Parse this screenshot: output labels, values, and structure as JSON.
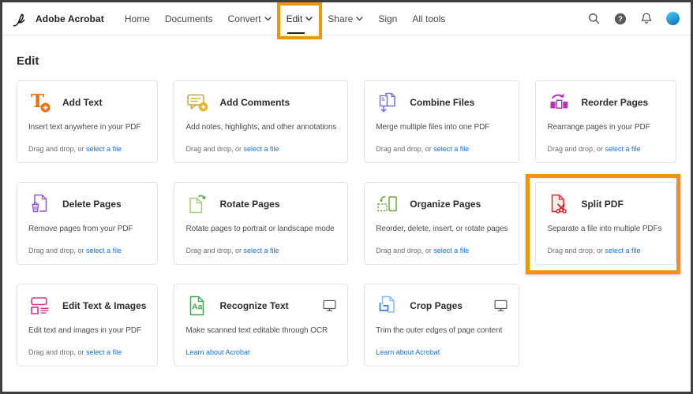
{
  "nav": {
    "brand": "Adobe Acrobat",
    "items": [
      {
        "label": "Home"
      },
      {
        "label": "Documents"
      },
      {
        "label": "Convert",
        "caret": true
      },
      {
        "label": "Edit",
        "caret": true,
        "active": true
      },
      {
        "label": "Share",
        "caret": true
      },
      {
        "label": "Sign"
      },
      {
        "label": "All tools"
      }
    ],
    "icons": [
      "search-icon",
      "help-icon",
      "notifications-bell-icon",
      "account-avatar"
    ],
    "help_glyph": "?"
  },
  "page": {
    "heading": "Edit"
  },
  "annotations": {
    "highlight_color": "#F2930D",
    "highlighted_nav_item": "Edit",
    "highlighted_card": "Split PDF"
  },
  "cards": [
    {
      "icon": "add-text-icon",
      "title": "Add Text",
      "desc": "Insert text anywhere in your PDF",
      "footer": {
        "prefix": "Drag and drop, or ",
        "link": "select a file"
      }
    },
    {
      "icon": "add-comments-icon",
      "title": "Add Comments",
      "desc": "Add notes, highlights, and other annotations",
      "footer": {
        "prefix": "Drag and drop, or ",
        "link": "select a file"
      }
    },
    {
      "icon": "combine-files-icon",
      "title": "Combine Files",
      "desc": "Merge multiple files into one PDF",
      "footer": {
        "prefix": "Drag and drop, or ",
        "link": "select a file"
      }
    },
    {
      "icon": "reorder-pages-icon",
      "title": "Reorder Pages",
      "desc": "Rearrange pages in your PDF",
      "footer": {
        "prefix": "Drag and drop, or ",
        "link": "select a file"
      }
    },
    {
      "icon": "delete-pages-icon",
      "title": "Delete Pages",
      "desc": "Remove pages from your PDF",
      "footer": {
        "prefix": "Drag and drop, or ",
        "link": "select a file"
      }
    },
    {
      "icon": "rotate-pages-icon",
      "title": "Rotate Pages",
      "desc": "Rotate pages to portrait or landscape mode",
      "footer": {
        "prefix": "Drag and drop, or ",
        "link": "select a file"
      }
    },
    {
      "icon": "organize-pages-icon",
      "title": "Organize Pages",
      "desc": "Reorder, delete, insert, or rotate pages",
      "footer": {
        "prefix": "Drag and drop, or ",
        "link": "select a file"
      }
    },
    {
      "icon": "split-pdf-icon",
      "title": "Split PDF",
      "desc": "Separate a file into multiple PDFs",
      "footer": {
        "prefix": "Drag and drop, or ",
        "link": "select a file"
      },
      "highlighted": true
    },
    {
      "icon": "edit-text-images-icon",
      "title": "Edit Text & Images",
      "desc": "Edit text and images in your PDF",
      "footer": {
        "prefix": "Drag and drop, or ",
        "link": "select a file"
      }
    },
    {
      "icon": "recognize-text-icon",
      "title": "Recognize Text",
      "desc": "Make scanned text editable through OCR",
      "footer": {
        "link": "Learn about Acrobat"
      },
      "desktop_only": true
    },
    {
      "icon": "crop-pages-icon",
      "title": "Crop Pages",
      "desc": "Trim the outer edges of page content",
      "footer": {
        "link": "Learn about Acrobat"
      },
      "desktop_only": true
    }
  ],
  "colors": {
    "annotation_orange": "#F2930D",
    "link_blue": "#1473E6",
    "add_text_orange": "#E8720C",
    "add_comments_gold": "#D9A909",
    "combine_files_periwinkle": "#7373E8",
    "reorder_pages_magenta": "#BC2EC4",
    "delete_pages_purple": "#9256D9",
    "rotate_pages_green": "#7FB84B",
    "organize_pages_green": "#6FA83C",
    "split_pdf_red": "#E5252A",
    "edit_text_images_pink": "#D0368F",
    "recognize_text_green": "#3DA74E",
    "crop_pages_blue": "#2A7DE1"
  }
}
